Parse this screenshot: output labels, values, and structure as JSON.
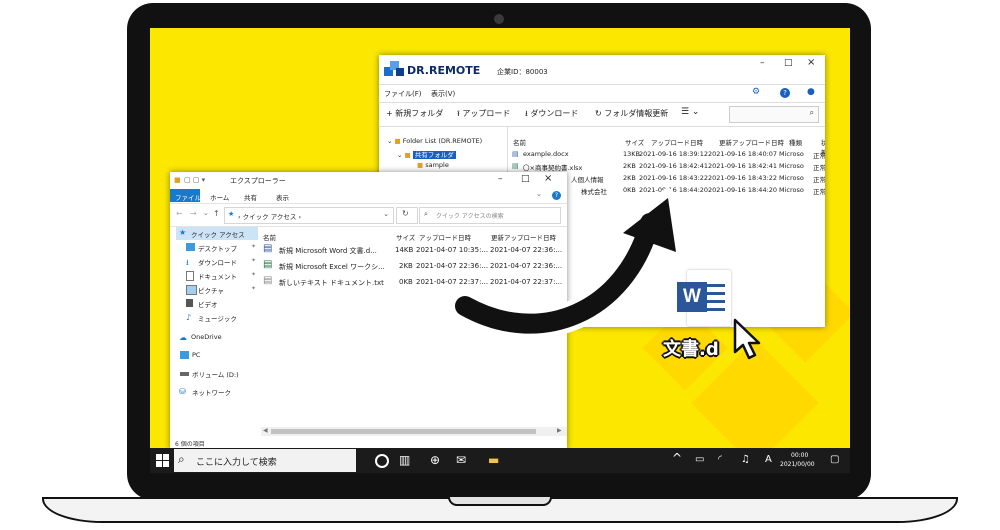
{
  "dr_window": {
    "logo_text": "DR.REMOTE",
    "company_id": "企業ID：80003",
    "menu": [
      "ファイル(F)",
      "表示(V)"
    ],
    "toolbar": {
      "new_folder": "新規フォルダ",
      "upload": "アップロード",
      "download": "ダウンロード",
      "refresh": "フォルダ情報更新"
    },
    "tree": {
      "root": "Folder List (DR.REMOTE)",
      "shared": "共有フォルダ",
      "sample": "sample"
    },
    "columns": [
      "名前",
      "サイズ",
      "アップロード日時",
      "更新アップロード日時",
      "種類",
      "状態"
    ],
    "rows": [
      {
        "name": "example.docx",
        "size": "13KB",
        "uploaded": "2021-09-16 18:39:12",
        "updated": "2021-09-16 18:40:07",
        "type": "Microso",
        "status": "正常"
      },
      {
        "name": "〇×商事契約書.xlsx",
        "size": "2KB",
        "uploaded": "2021-09-16 18:42:41",
        "updated": "2021-09-16 18:42:41",
        "type": "Microso",
        "status": "正常"
      },
      {
        "name": "人個人情報",
        "size": "2KB",
        "uploaded": "2021-09-16 18:43:22",
        "updated": "2021-09-16 18:43:22",
        "type": "Microso",
        "status": "正常"
      },
      {
        "name": "株式会社",
        "size": "0KB",
        "uploaded": "2021-09-16 18:44:20",
        "updated": "2021-09-16 18:44:20",
        "type": "Microso",
        "status": "正常"
      }
    ]
  },
  "explorer": {
    "title": "エクスプローラー",
    "ribbon_tabs": [
      "ファイル",
      "ホーム",
      "共有",
      "表示"
    ],
    "breadcrumb": "クイック アクセス",
    "search_placeholder": "クイック アクセスの検索",
    "nav": [
      "クイック アクセス",
      "デスクトップ",
      "ダウンロード",
      "ドキュメント",
      "ピクチャ",
      "ビデオ",
      "ミュージック",
      "OneDrive",
      "PC",
      "ボリューム (D:)",
      "ネットワーク"
    ],
    "columns": [
      "名前",
      "サイズ",
      "アップロード日時",
      "更新アップロード日時"
    ],
    "rows": [
      {
        "name": "新規 Microsoft Word 文書.d...",
        "size": "14KB",
        "uploaded": "2021-04-07 10:35:...",
        "updated": "2021-04-07 22:36:..."
      },
      {
        "name": "新規 Microsoft Excel ワークシ...",
        "size": "2KB",
        "uploaded": "2021-04-07 22:36:...",
        "updated": "2021-04-07 22:36:..."
      },
      {
        "name": "新しいテキスト ドキュメント.txt",
        "size": "0KB",
        "uploaded": "2021-04-07 22:37:...",
        "updated": "2021-04-07 22:37:..."
      }
    ],
    "status": "6 個の項目"
  },
  "drag": {
    "label": "文書.d",
    "icon_letter": "W"
  },
  "taskbar": {
    "search_text": "ここに入力して検索",
    "ime": "A",
    "time": "00:00",
    "date": "2021/00/00"
  },
  "colors": {
    "desktop": "#fbe700",
    "word": "#2b579a",
    "excel": "#217346",
    "accent": "#0a64c9"
  }
}
